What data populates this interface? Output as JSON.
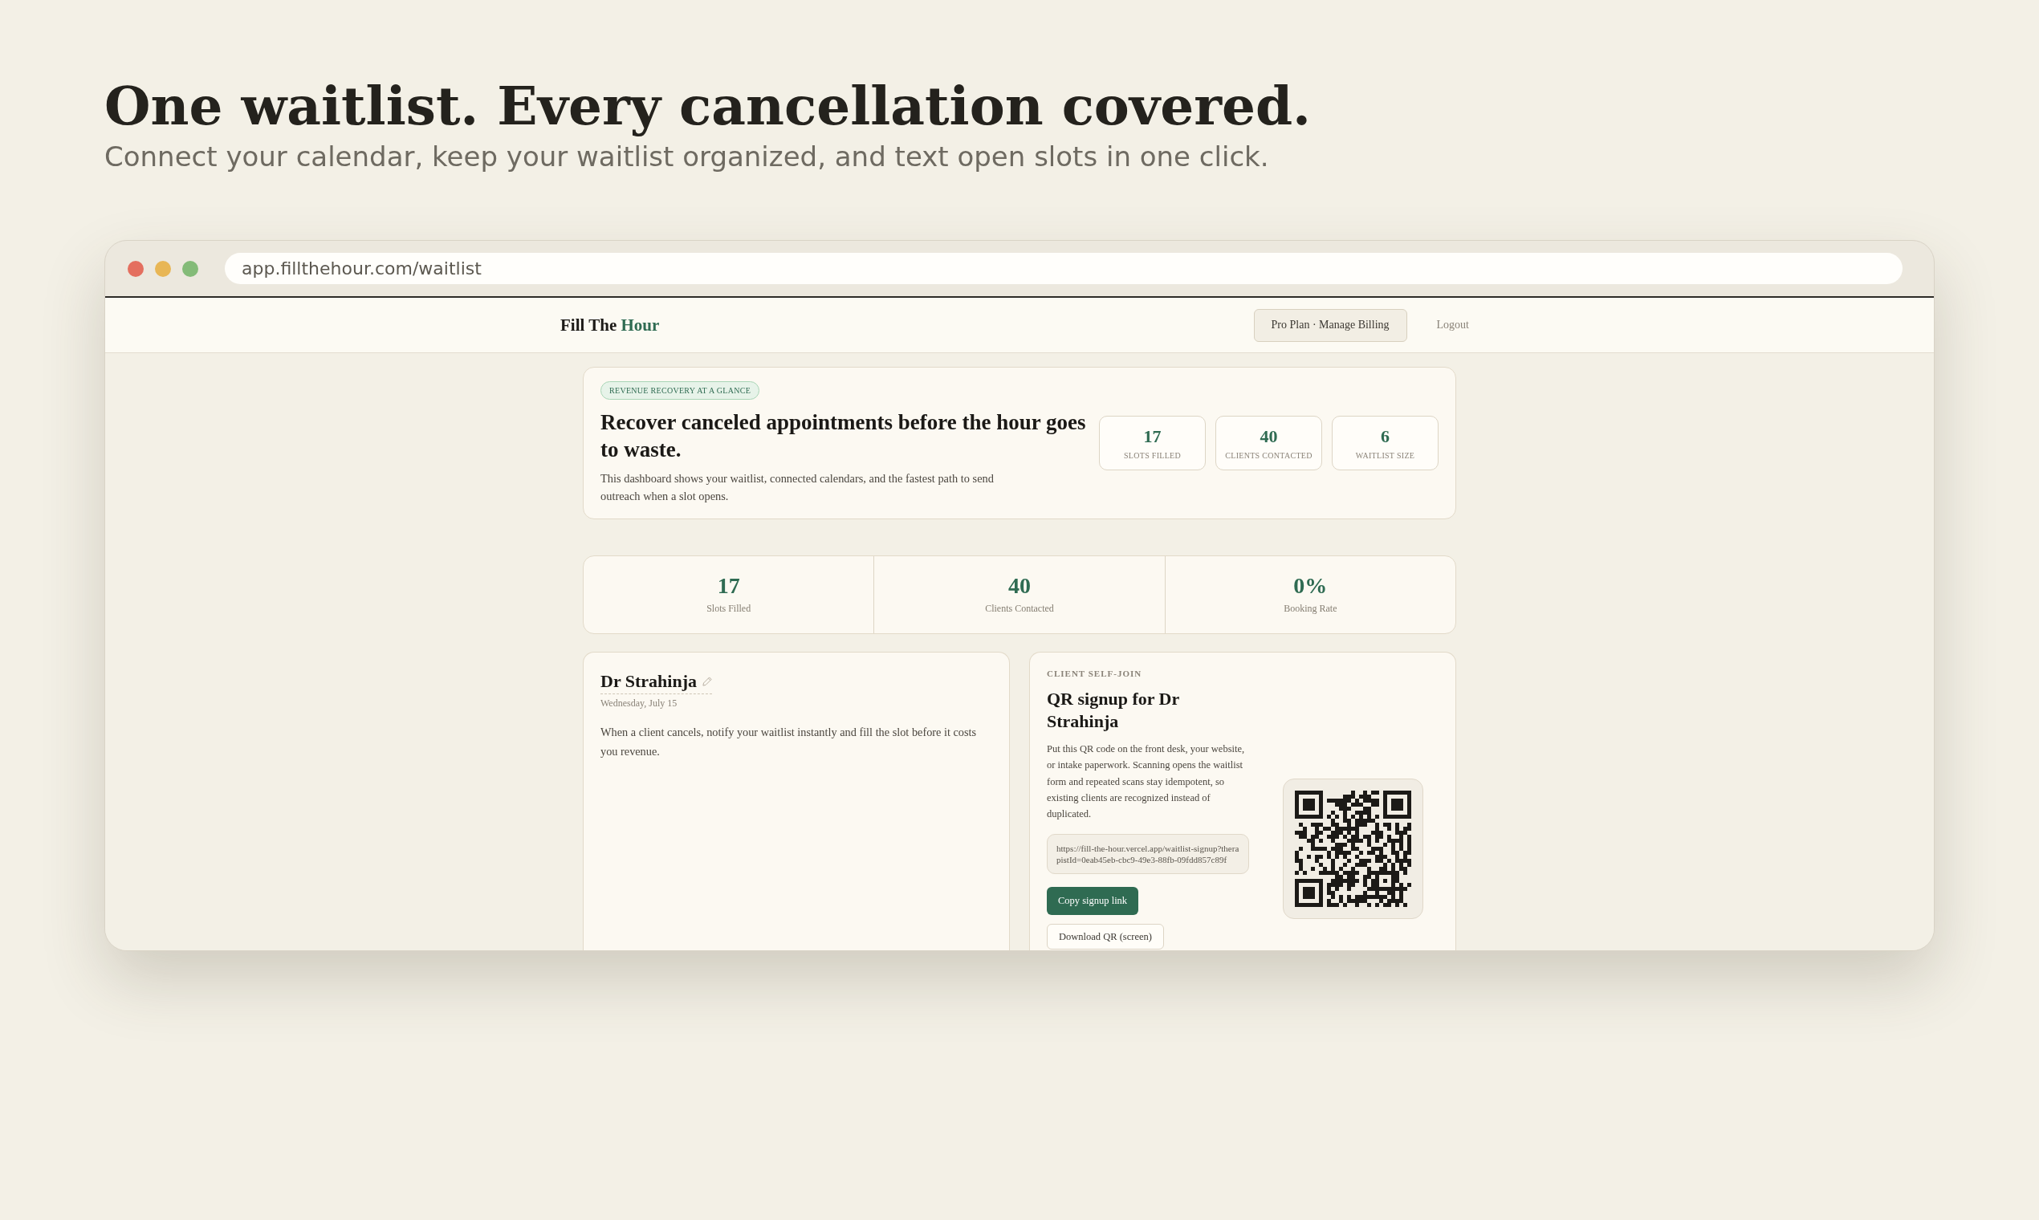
{
  "intro": {
    "title": "One waitlist. Every cancellation covered.",
    "subtitle": "Connect your calendar, keep your waitlist organized, and text open slots in one click."
  },
  "browser": {
    "url": "app.fillthehour.com/waitlist"
  },
  "nav": {
    "brand": "Fill The",
    "brand_accent": "Hour",
    "plan_button": "Pro Plan · Manage Billing",
    "logout": "Logout"
  },
  "hero": {
    "badge": "REVENUE RECOVERY AT A GLANCE",
    "title": "Recover canceled appointments before the hour goes to waste.",
    "description": "This dashboard shows your waitlist, connected calendars, and the fastest path to send outreach when a slot opens.",
    "stats": [
      {
        "value": "17",
        "label": "SLOTS FILLED"
      },
      {
        "value": "40",
        "label": "CLIENTS CONTACTED"
      },
      {
        "value": "6",
        "label": "WAITLIST SIZE"
      }
    ]
  },
  "summary_stats": [
    {
      "value": "17",
      "label": "Slots Filled"
    },
    {
      "value": "40",
      "label": "Clients Contacted"
    },
    {
      "value": "0%",
      "label": "Booking Rate"
    }
  ],
  "provider_card": {
    "name": "Dr Strahinja",
    "date": "Wednesday, July 15",
    "description": "When a client cancels, notify your waitlist instantly and fill the slot before it costs you revenue."
  },
  "self_join": {
    "eyebrow": "CLIENT SELF-JOIN",
    "title": "QR signup for Dr Strahinja",
    "description": "Put this QR code on the front desk, your website, or intake paperwork. Scanning opens the waitlist form and repeated scans stay idempotent, so existing clients are recognized instead of duplicated.",
    "signup_url": "https://fill-the-hour.vercel.app/waitlist-signup?therapistId=0eab45eb-cbc9-49e3-88fb-09fdd857c89f",
    "buttons": [
      {
        "label": "Copy signup link",
        "kind": "primary"
      },
      {
        "label": "Download QR (screen)",
        "kind": "secondary"
      }
    ]
  }
}
